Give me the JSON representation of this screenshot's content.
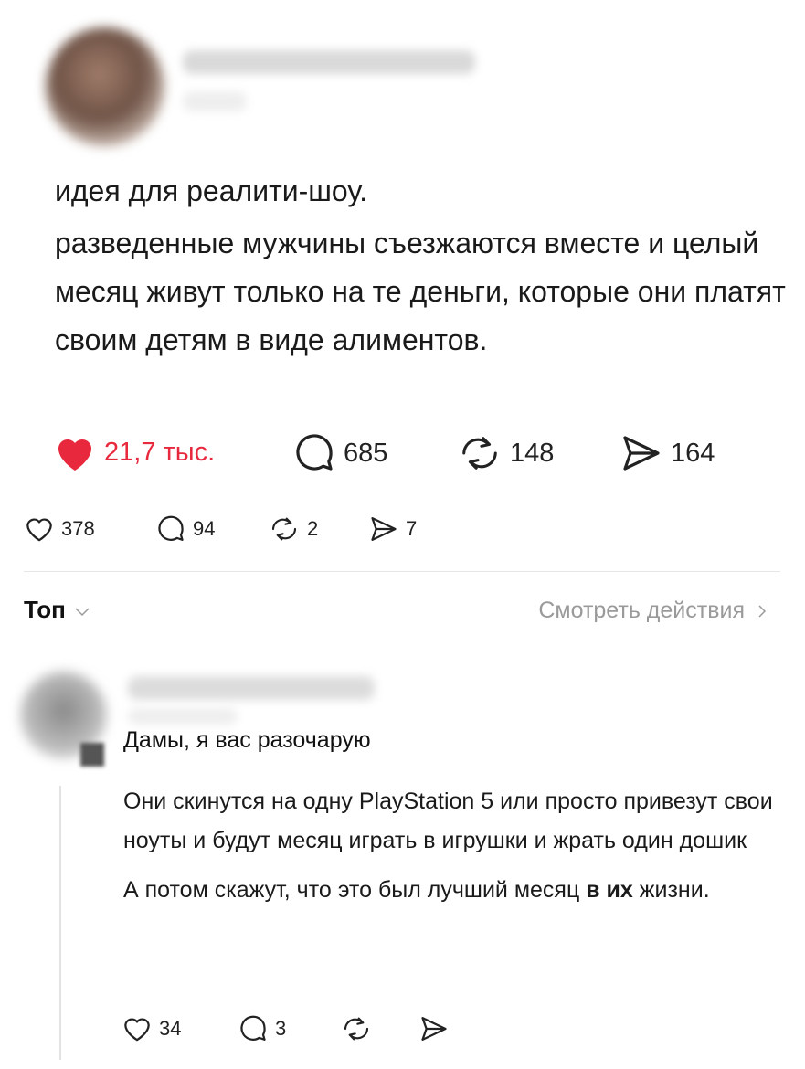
{
  "post": {
    "lines": [
      "идея для реалити-шоу.",
      "разведенные мужчины съезжаются вместе и целый месяц живут только на те деньги, которые они платят своим детям в виде алиментов."
    ],
    "stats": {
      "likes": "21,7 тыс.",
      "comments": "685",
      "reposts": "148",
      "shares": "164"
    }
  },
  "secondary_stats": {
    "likes": "378",
    "comments": "94",
    "reposts": "2",
    "shares": "7"
  },
  "sort": {
    "label": "Топ",
    "actions_link": "Смотреть действия"
  },
  "comment": {
    "title": "Дамы, я вас разочарую",
    "paragraph1": "Они скинутся на одну PlayStation 5 или просто привезут свои ноуты и будут месяц играть в игрушки и жрать один дошик",
    "paragraph2_start": "А потом скажут, что это был лучший месяц",
    "paragraph2_bold": "в их",
    "paragraph2_end": "жизни.",
    "stats": {
      "likes": "34",
      "comments": "3"
    }
  },
  "colors": {
    "like_red": "#e8283c",
    "muted": "#9a9a9a"
  }
}
